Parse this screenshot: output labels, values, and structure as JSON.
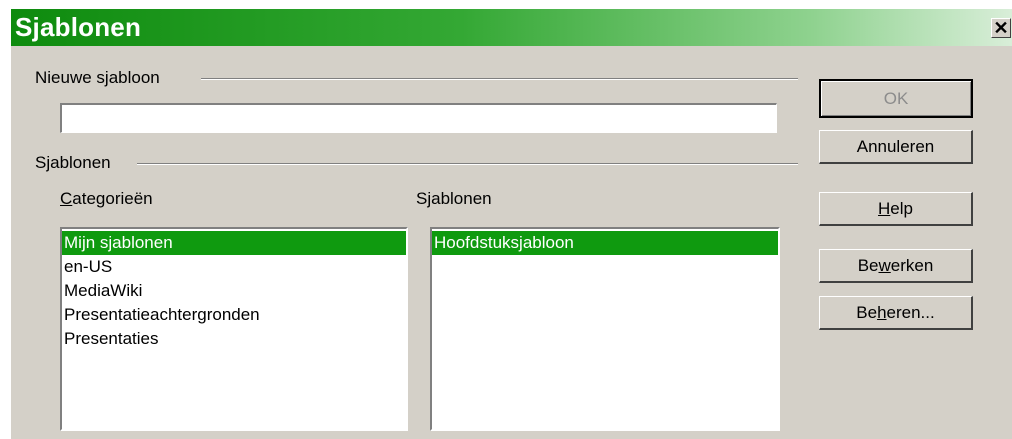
{
  "dialog": {
    "title": "Sjablonen",
    "close_icon": "close-icon"
  },
  "new_template": {
    "group_label": "Nieuwe sjabloon",
    "value": "",
    "placeholder": ""
  },
  "templates_group": {
    "group_label": "Sjablonen",
    "categories": {
      "label_pre": "",
      "label_mnemonic": "C",
      "label_post": "ategorieën",
      "items": [
        "Mijn sjablonen",
        "en-US",
        "MediaWiki",
        "Presentatieachtergronden",
        "Presentaties"
      ],
      "selected": "Mijn sjablonen"
    },
    "templates": {
      "label_pre": "S",
      "label_mnemonic": "j",
      "label_post": "ablonen",
      "items": [
        "Hoofdstuksjabloon"
      ],
      "selected": "Hoofdstuksjabloon"
    }
  },
  "buttons": {
    "ok": {
      "label": "OK",
      "enabled": false
    },
    "cancel": {
      "label": "Annuleren"
    },
    "help": {
      "pre": "",
      "mnemonic": "H",
      "post": "elp"
    },
    "edit": {
      "pre": "Be",
      "mnemonic": "w",
      "post": "erken"
    },
    "manage": {
      "pre": "Be",
      "mnemonic": "h",
      "post": "eren..."
    }
  },
  "colors": {
    "titlebar_start": "#0e8b0e",
    "selection": "#0f9a0f",
    "dialog_bg": "#d4d0c8"
  }
}
